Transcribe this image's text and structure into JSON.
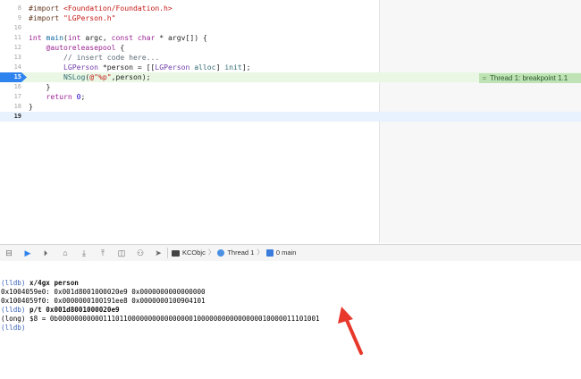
{
  "editor": {
    "lines": [
      {
        "num": "8",
        "tokens": [
          {
            "t": "#import ",
            "c": "pp"
          },
          {
            "t": "<Foundation/Foundation.h>",
            "c": "str"
          }
        ]
      },
      {
        "num": "9",
        "tokens": [
          {
            "t": "#import ",
            "c": "pp"
          },
          {
            "t": "\"LGPerson.h\"",
            "c": "str"
          }
        ]
      },
      {
        "num": "10",
        "tokens": []
      },
      {
        "num": "11",
        "tokens": [
          {
            "t": "int ",
            "c": "kw"
          },
          {
            "t": "main",
            "c": "fn2"
          },
          {
            "t": "(",
            "c": "plain"
          },
          {
            "t": "int ",
            "c": "kw"
          },
          {
            "t": "argc, ",
            "c": "plain"
          },
          {
            "t": "const char ",
            "c": "kw"
          },
          {
            "t": "* argv[]) {",
            "c": "plain"
          }
        ]
      },
      {
        "num": "12",
        "tokens": [
          {
            "t": "    ",
            "c": "plain"
          },
          {
            "t": "@autoreleasepool",
            "c": "kw"
          },
          {
            "t": " {",
            "c": "plain"
          }
        ]
      },
      {
        "num": "13",
        "tokens": [
          {
            "t": "        ",
            "c": "plain"
          },
          {
            "t": "// insert code here...",
            "c": "cm"
          }
        ]
      },
      {
        "num": "14",
        "tokens": [
          {
            "t": "        ",
            "c": "plain"
          },
          {
            "t": "LGPerson",
            "c": "cls"
          },
          {
            "t": " *person = [[",
            "c": "plain"
          },
          {
            "t": "LGPerson",
            "c": "cls"
          },
          {
            "t": " ",
            "c": "plain"
          },
          {
            "t": "alloc",
            "c": "fn"
          },
          {
            "t": "] ",
            "c": "plain"
          },
          {
            "t": "init",
            "c": "fn"
          },
          {
            "t": "];",
            "c": "plain"
          }
        ]
      },
      {
        "num": "15",
        "tokens": [
          {
            "t": "        ",
            "c": "plain"
          },
          {
            "t": "NSLog",
            "c": "fn"
          },
          {
            "t": "(",
            "c": "plain"
          },
          {
            "t": "@\"%p\"",
            "c": "str"
          },
          {
            "t": ",person);",
            "c": "plain"
          }
        ]
      },
      {
        "num": "16",
        "tokens": [
          {
            "t": "    }",
            "c": "plain"
          }
        ]
      },
      {
        "num": "17",
        "tokens": [
          {
            "t": "    ",
            "c": "plain"
          },
          {
            "t": "return ",
            "c": "kw"
          },
          {
            "t": "0",
            "c": "num"
          },
          {
            "t": ";",
            "c": "plain"
          }
        ]
      },
      {
        "num": "18",
        "tokens": [
          {
            "t": "}",
            "c": "plain"
          }
        ]
      },
      {
        "num": "19",
        "tokens": []
      }
    ],
    "breakpoint_line": "15",
    "caret_line": "19",
    "thread_annotation": {
      "symbol": "=",
      "text": "Thread 1: breakpoint 1.1"
    }
  },
  "debug_bar": {
    "buttons": [
      {
        "name": "hide-console-button",
        "glyph": "⊟"
      },
      {
        "name": "breakpoints-toggle-button",
        "glyph": "▶",
        "active": true
      },
      {
        "name": "continue-button",
        "glyph": "⏵"
      },
      {
        "name": "step-over-button",
        "glyph": "⌂"
      },
      {
        "name": "step-into-button",
        "glyph": "⤓"
      },
      {
        "name": "step-out-button",
        "glyph": "⤒"
      },
      {
        "name": "debug-view-hierarchy-button",
        "glyph": "◫"
      },
      {
        "name": "memory-graph-button",
        "glyph": "⚇"
      },
      {
        "name": "simulate-location-button",
        "glyph": "➤"
      }
    ],
    "breadcrumb": {
      "target": "KCObjc",
      "thread": "Thread 1",
      "frame": "0 main"
    }
  },
  "console": {
    "lines": [
      {
        "prompt": "(lldb)",
        "cmd": "x/4gx person"
      },
      {
        "text": "0x1004059e0: 0x001d8001000020e9 0x0000000000000000"
      },
      {
        "text": "0x1004059f0: 0x0000000100191ee8 0x0000000100904101"
      },
      {
        "prompt": "(lldb)",
        "cmd": "p/t 0x001d8001000020e9"
      },
      {
        "text": "(long) $8 = 0b0000000000011101100000000000000001000000000000000010000011101001"
      },
      {
        "prompt": "(lldb)",
        "cmd": ""
      }
    ]
  },
  "colors": {
    "arrow": "#e8382c",
    "breakpoint": "#2f83ef",
    "current_line": "#e9f7e4",
    "thread_label": "#bfe3b4"
  }
}
